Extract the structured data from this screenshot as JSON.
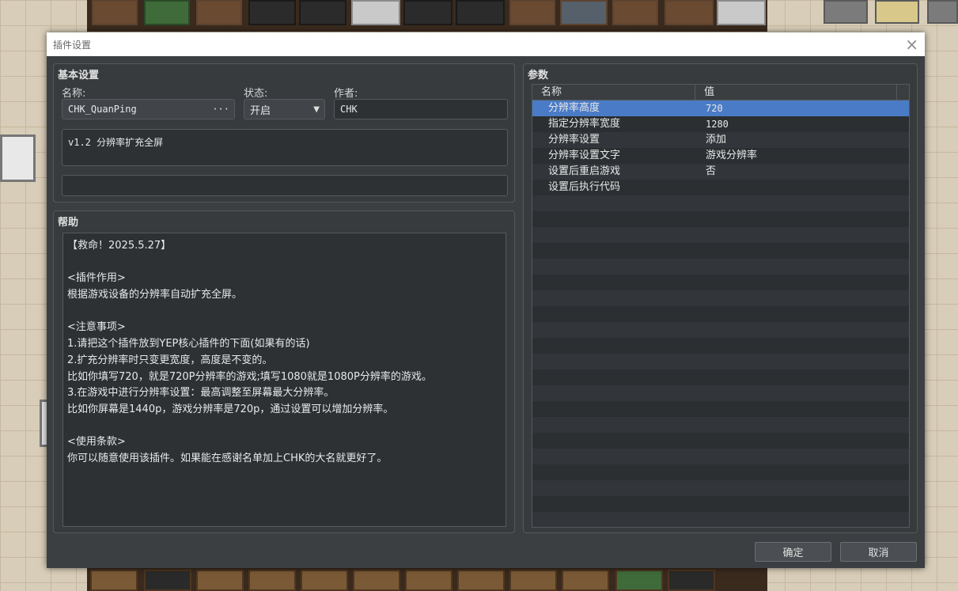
{
  "dialog": {
    "title": "插件设置",
    "close_glyph": "×"
  },
  "basic": {
    "group_title": "基本设置",
    "name_label": "名称:",
    "name_value": "CHK_QuanPing",
    "status_label": "状态:",
    "status_value": "开启",
    "author_label": "作者:",
    "author_value": "CHK",
    "description": "v1.2 分辨率扩充全屏",
    "extra": ""
  },
  "help": {
    "group_title": "帮助",
    "lines": [
      "【救命！2025.5.27】",
      "",
      "<插件作用>",
      "根据游戏设备的分辨率自动扩充全屏。",
      "",
      "<注意事项>",
      "1.请把这个插件放到YEP核心插件的下面(如果有的话)",
      "2.扩充分辨率时只变更宽度，高度是不变的。",
      "比如你填写720，就是720P分辨率的游戏;填写1080就是1080P分辨率的游戏。",
      "3.在游戏中进行分辨率设置：最高调整至屏幕最大分辨率。",
      "比如你屏幕是1440p，游戏分辨率是720p，通过设置可以增加分辨率。",
      "",
      "<使用条款>",
      "你可以随意使用该插件。如果能在感谢名单加上CHK的大名就更好了。"
    ]
  },
  "params": {
    "group_title": "参数",
    "col_name": "名称",
    "col_value": "值",
    "rows": [
      {
        "name": "分辨率高度",
        "value": "720"
      },
      {
        "name": "指定分辨率宽度",
        "value": "1280"
      },
      {
        "name": "分辨率设置",
        "value": "添加"
      },
      {
        "name": "分辨率设置文字",
        "value": "游戏分辨率"
      },
      {
        "name": "设置后重启游戏",
        "value": "否"
      },
      {
        "name": "设置后执行代码",
        "value": ""
      }
    ]
  },
  "buttons": {
    "ok": "确定",
    "cancel": "取消"
  },
  "icons": {
    "ellipsis": "···",
    "dropdown": "▼"
  }
}
